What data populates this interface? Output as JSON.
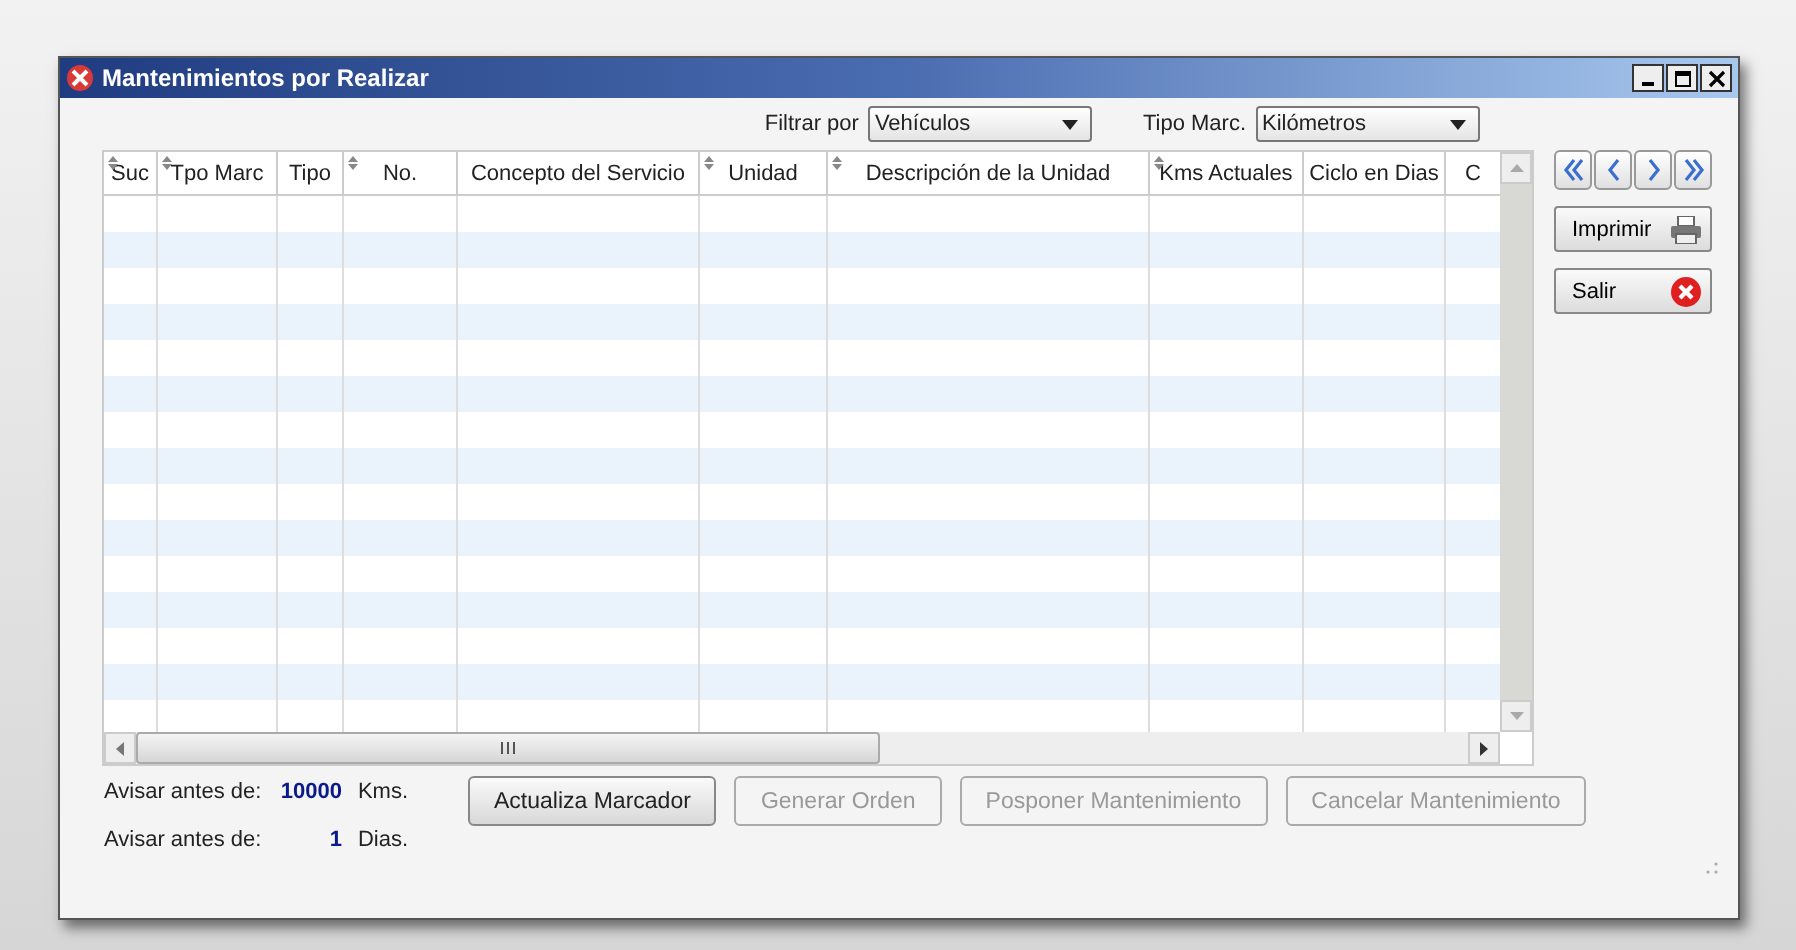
{
  "window": {
    "title": "Mantenimientos por Realizar"
  },
  "filters": [
    {
      "label": "Filtrar por",
      "value": "Vehículos"
    },
    {
      "label": "Tipo Marc.",
      "value": "Kilómetros"
    }
  ],
  "table": {
    "columns": [
      {
        "label": "Suc",
        "sortable": true
      },
      {
        "label": "Tpo Marc",
        "sortable": true
      },
      {
        "label": "Tipo",
        "sortable": false
      },
      {
        "label": "No.",
        "sortable": true
      },
      {
        "label": "Concepto del Servicio",
        "sortable": false
      },
      {
        "label": "Unidad",
        "sortable": true
      },
      {
        "label": "Descripción de la Unidad",
        "sortable": true
      },
      {
        "label": "Kms Actuales",
        "sortable": true
      },
      {
        "label": "Ciclo en Dias",
        "sortable": false
      },
      {
        "label": "C",
        "sortable": false
      }
    ]
  },
  "side_buttons": [
    {
      "label": "Imprimir",
      "kind": "print"
    },
    {
      "label": "Salir",
      "kind": "exit"
    }
  ],
  "warnings": [
    {
      "label": "Avisar antes de:",
      "value": "10000",
      "unit": "Kms."
    },
    {
      "label": "Avisar antes de:",
      "value": "1",
      "unit": "Dias."
    }
  ],
  "actions": [
    {
      "label": "Actualiza Marcador",
      "disabled": false
    },
    {
      "label": "Generar Orden",
      "disabled": true
    },
    {
      "label": "Posponer Mantenimiento",
      "disabled": true
    },
    {
      "label": "Cancelar Mantenimiento",
      "disabled": true
    }
  ]
}
